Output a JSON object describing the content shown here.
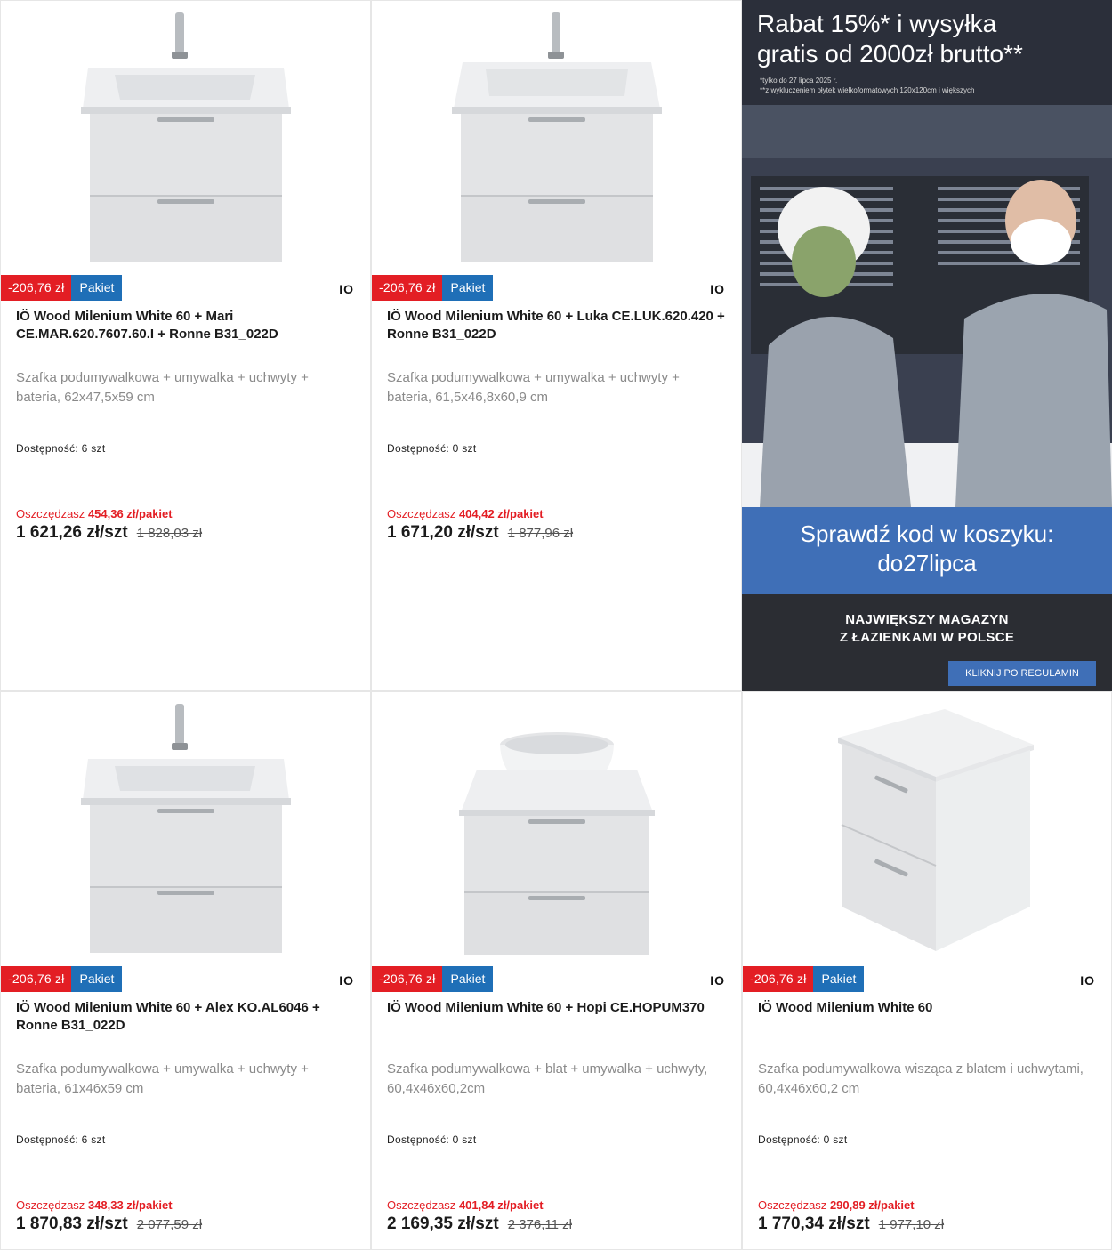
{
  "products": [
    {
      "discount": "-206,76 zł",
      "pakiet": "Pakiet",
      "brand": "IO",
      "title": "IÖ Wood Milenium White 60 + Mari CE.MAR.620.7607.60.I + Ronne B31_022D",
      "desc": "Szafka podumywalkowa + umywalka + uchwyty + bateria, 62x47,5x59 cm",
      "availability": "Dostępność: 6 szt",
      "save_label": "Oszczędzasz",
      "save_value": "454,36 zł/pakiet",
      "price": "1 621,26 zł/szt",
      "old_price": "1 828,03 zł",
      "image": "vanity-sink-faucet"
    },
    {
      "discount": "-206,76 zł",
      "pakiet": "Pakiet",
      "brand": "IO",
      "title": "IÖ Wood Milenium White 60 + Luka CE.LUK.620.420 + Ronne B31_022D",
      "desc": "Szafka podumywalkowa + umywalka + uchwyty + bateria, 61,5x46,8x60,9 cm",
      "availability": "Dostępność: 0 szt",
      "save_label": "Oszczędzasz",
      "save_value": "404,42 zł/pakiet",
      "price": "1 671,20 zł/szt",
      "old_price": "1 877,96 zł",
      "image": "vanity-sink-faucet"
    },
    {
      "discount": "-206,76 zł",
      "pakiet": "Pakiet",
      "brand": "IO",
      "title": "IÖ Wood Milenium White 60 + Alex KO.AL6046 + Ronne B31_022D",
      "desc": "Szafka podumywalkowa + umywalka + uchwyty + bateria, 61x46x59 cm",
      "availability": "Dostępność: 6 szt",
      "save_label": "Oszczędzasz",
      "save_value": "348,33 zł/pakiet",
      "price": "1 870,83 zł/szt",
      "old_price": "2 077,59 zł",
      "image": "vanity-sink-faucet"
    },
    {
      "discount": "-206,76 zł",
      "pakiet": "Pakiet",
      "brand": "IO",
      "title": "IÖ Wood Milenium White 60 + Hopi CE.HOPUM370",
      "desc": "Szafka podumywalkowa + blat + umywalka + uchwyty, 60,4x46x60,2cm",
      "availability": "Dostępność: 0 szt",
      "save_label": "Oszczędzasz",
      "save_value": "401,84 zł/pakiet",
      "price": "2 169,35 zł/szt",
      "old_price": "2 376,11 zł",
      "image": "vanity-bowl"
    },
    {
      "discount": "-206,76 zł",
      "pakiet": "Pakiet",
      "brand": "IO",
      "title": "IÖ Wood Milenium White 60",
      "desc": "Szafka podumywalkowa wisząca z blatem i uchwytami, 60,4x46x60,2 cm",
      "availability": "Dostępność: 0 szt",
      "save_label": "Oszczędzasz",
      "save_value": "290,89 zł/pakiet",
      "price": "1 770,34 zł/szt",
      "old_price": "1 977,10 zł",
      "image": "vanity-cabinet"
    }
  ],
  "ad": {
    "headline_1": "Rabat 15%* i wysyłka",
    "headline_2": "gratis od 2000zł brutto**",
    "note_1": "*tylko do 27 lipca 2025 r.",
    "note_2": "**z wykluczeniem płytek wielkoformatowych 120x120cm i większych",
    "code_1": "Sprawdź kod w koszyku:",
    "code_2": "do27lipca",
    "slogan_1": "NAJWIĘKSZY MAGAZYN",
    "slogan_2": "Z ŁAZIENKAMI W POLSCE",
    "button": "KLIKNIJ PO REGULAMIN"
  }
}
